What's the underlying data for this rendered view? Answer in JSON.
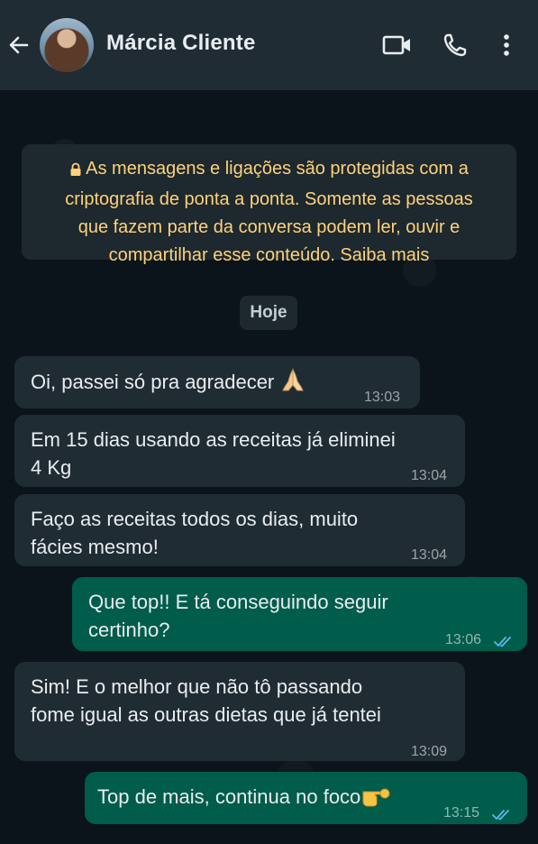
{
  "header": {
    "contact_name": "Márcia Cliente",
    "icons": [
      "back-arrow-icon",
      "video-call-icon",
      "phone-call-icon",
      "more-options-icon"
    ]
  },
  "encryption_notice": {
    "line1": "As mensagens e ligações são protegidas com a",
    "line2": "criptografia de ponta a ponta. Somente as pessoas",
    "line3": "que fazem parte da conversa podem ler, ouvir e",
    "line4": "compartilhar esse conteúdo. Saiba mais"
  },
  "day_label": "Hoje",
  "messages": [
    {
      "direction": "in",
      "lines": [
        "Oi, passei só pra agradecer"
      ],
      "emoji": "🙏",
      "time": "13:03"
    },
    {
      "direction": "in",
      "lines": [
        "Em 15 dias usando as receitas já eliminei",
        "4 Kg"
      ],
      "time": "13:04"
    },
    {
      "direction": "in",
      "lines": [
        "Faço as receitas todos os dias, muito",
        "fácies mesmo!"
      ],
      "time": "13:04"
    },
    {
      "direction": "out",
      "lines": [
        "Que top!! E tá conseguindo seguir",
        "certinho?"
      ],
      "time": "13:06",
      "status": "read"
    },
    {
      "direction": "in",
      "lines": [
        "Sim! E o melhor que não tô passando",
        "fome igual as outras dietas que já tentei"
      ],
      "time": "13:09"
    },
    {
      "direction": "out",
      "lines": [
        "Top de mais, continua no foco"
      ],
      "emoji": "🫵",
      "time": "13:15",
      "status": "read"
    }
  ],
  "colors": {
    "background": "#0b141a",
    "header": "#1f2c34",
    "incoming_bubble": "#1f2c34",
    "outgoing_bubble": "#005c4b",
    "notice_text": "#ffd279",
    "read_ticks": "#53bdeb"
  }
}
